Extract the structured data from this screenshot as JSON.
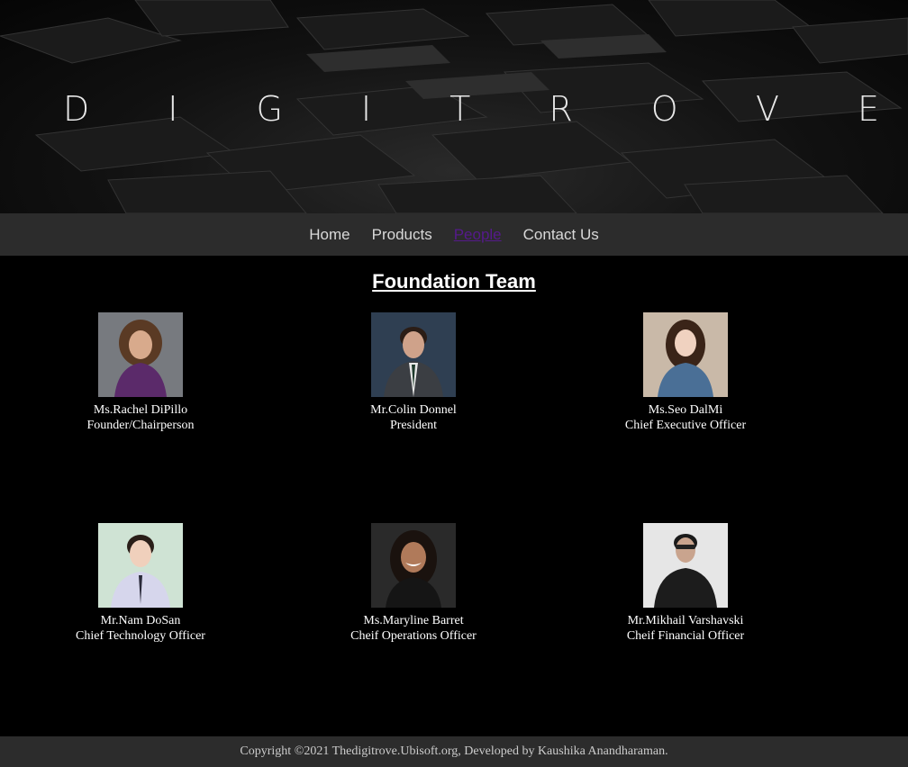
{
  "banner": {
    "title": "DIGITROVE"
  },
  "nav": {
    "items": [
      {
        "label": "Home",
        "active": false
      },
      {
        "label": "Products",
        "active": false
      },
      {
        "label": "People",
        "active": true
      },
      {
        "label": "Contact Us",
        "active": false
      }
    ]
  },
  "section": {
    "title": "Foundation Team"
  },
  "team": [
    {
      "name": "Ms.Rachel DiPillo",
      "role": "Founder/Chairperson"
    },
    {
      "name": "Mr.Colin Donnel",
      "role": "President"
    },
    {
      "name": "Ms.Seo DalMi",
      "role": "Chief Executive Officer"
    },
    {
      "name": "Mr.Nam DoSan",
      "role": "Chief Technology Officer"
    },
    {
      "name": "Ms.Maryline Barret",
      "role": "Cheif Operations Officer"
    },
    {
      "name": "Mr.Mikhail Varshavski",
      "role": "Cheif Financial Officer"
    }
  ],
  "footer": {
    "text": "Copyright ©2021 Thedigitrove.Ubisoft.org, Developed by Kaushika Anandharaman."
  }
}
